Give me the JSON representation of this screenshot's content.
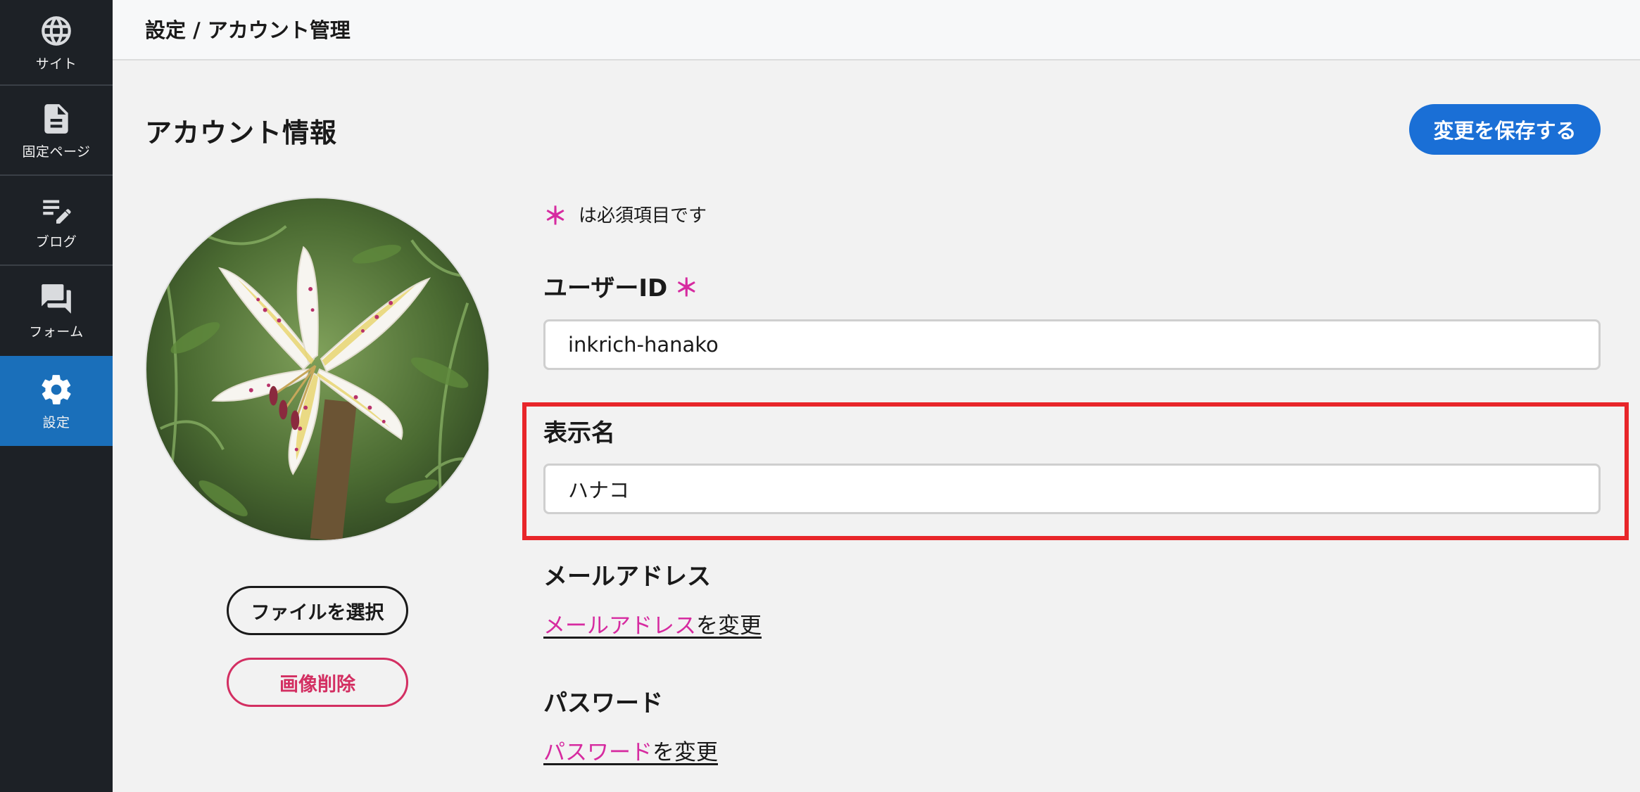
{
  "sidebar": {
    "items": [
      {
        "label": "サイト",
        "icon": "globe-icon"
      },
      {
        "label": "固定ページ",
        "icon": "document-icon"
      },
      {
        "label": "ブログ",
        "icon": "edit-note-icon"
      },
      {
        "label": "フォーム",
        "icon": "forum-icon"
      },
      {
        "label": "設定",
        "icon": "gear-icon",
        "active": true
      }
    ]
  },
  "header": {
    "breadcrumb": "設定 / アカウント管理"
  },
  "main": {
    "title": "アカウント情報",
    "save_label": "変更を保存する",
    "avatar": {
      "file_button_label": "ファイルを選択",
      "delete_button_label": "画像削除"
    },
    "required_note": "は必須項目です",
    "required_mark": "＊",
    "fields": {
      "user_id": {
        "label": "ユーザーID",
        "value": "inkrich-hanako"
      },
      "display_name": {
        "label": "表示名",
        "value": "ハナコ"
      },
      "email": {
        "label": "メールアドレス",
        "link_text": "メールアドレス",
        "suffix": "を変更"
      },
      "password": {
        "label": "パスワード",
        "link_text": "パスワード",
        "suffix": "を変更"
      }
    }
  },
  "colors": {
    "sidebar_bg": "#1d2126",
    "active_nav": "#1a6fba",
    "primary_button": "#1a6fd6",
    "accent_pink": "#d62ba0",
    "danger": "#d32f62",
    "highlight_red": "#e8262a"
  }
}
